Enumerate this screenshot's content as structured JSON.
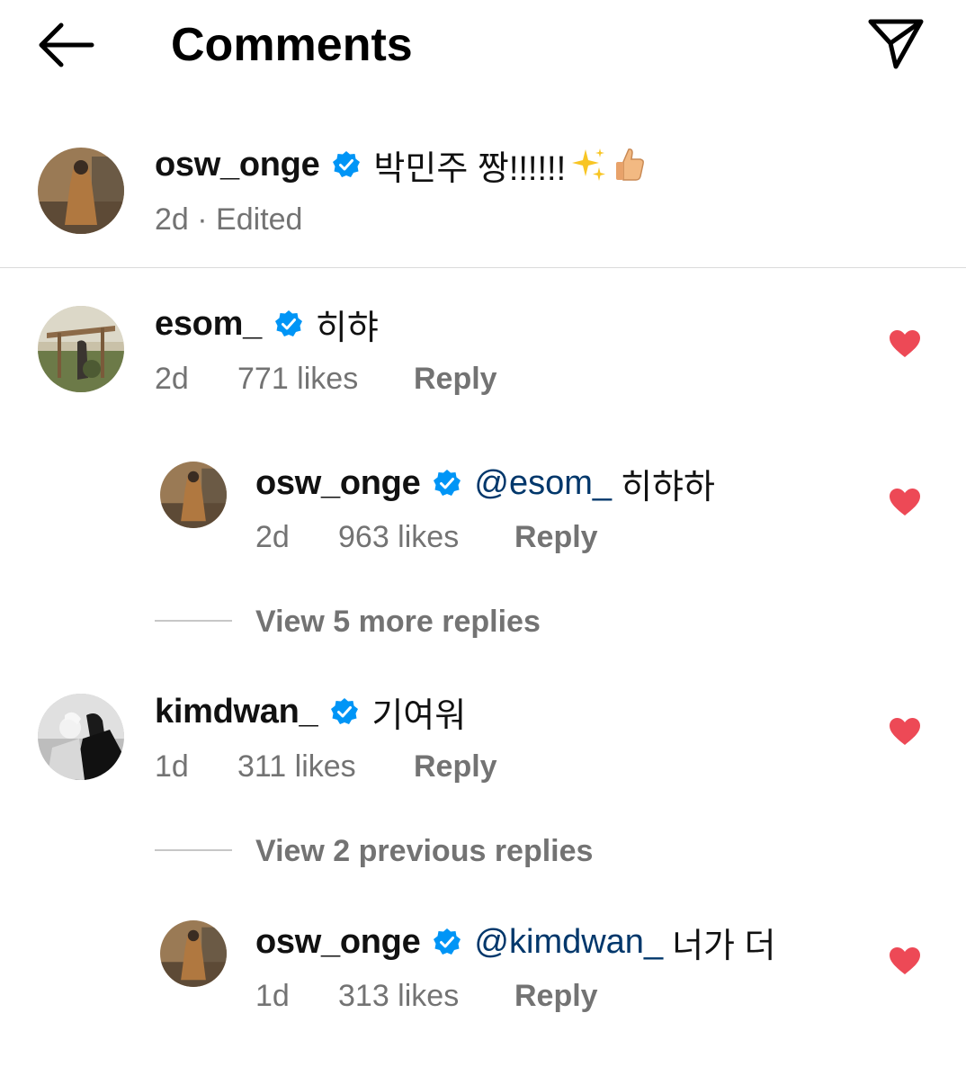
{
  "header": {
    "title": "Comments",
    "back_icon": "arrow-left-icon",
    "send_icon": "paper-plane-icon"
  },
  "colors": {
    "like_red": "#ed4956",
    "verified_blue": "#0095f6",
    "mention_blue": "#00376b",
    "meta_gray": "#737373"
  },
  "caption": {
    "username": "osw_onge",
    "text": "박민주 짱!!!!!!",
    "emoji": [
      "sparkles",
      "thumbs-up"
    ],
    "time": "2d",
    "edited": "· Edited"
  },
  "comments": [
    {
      "username": "esom_",
      "text": "히햐",
      "time": "2d",
      "likes": "771 likes",
      "reply_label": "Reply",
      "liked": true,
      "replies": [
        {
          "username": "osw_onge",
          "mention": "@esom_",
          "text": "히햐하",
          "time": "2d",
          "likes": "963 likes",
          "reply_label": "Reply",
          "liked": true
        }
      ],
      "view_more": "View 5 more replies"
    },
    {
      "username": "kimdwan_",
      "text": "기여워",
      "time": "1d",
      "likes": "311 likes",
      "reply_label": "Reply",
      "liked": true,
      "view_previous": "View 2 previous replies",
      "replies": [
        {
          "username": "osw_onge",
          "mention": "@kimdwan_",
          "text": "너가 더",
          "time": "1d",
          "likes": "313 likes",
          "reply_label": "Reply",
          "liked": true
        }
      ]
    }
  ]
}
